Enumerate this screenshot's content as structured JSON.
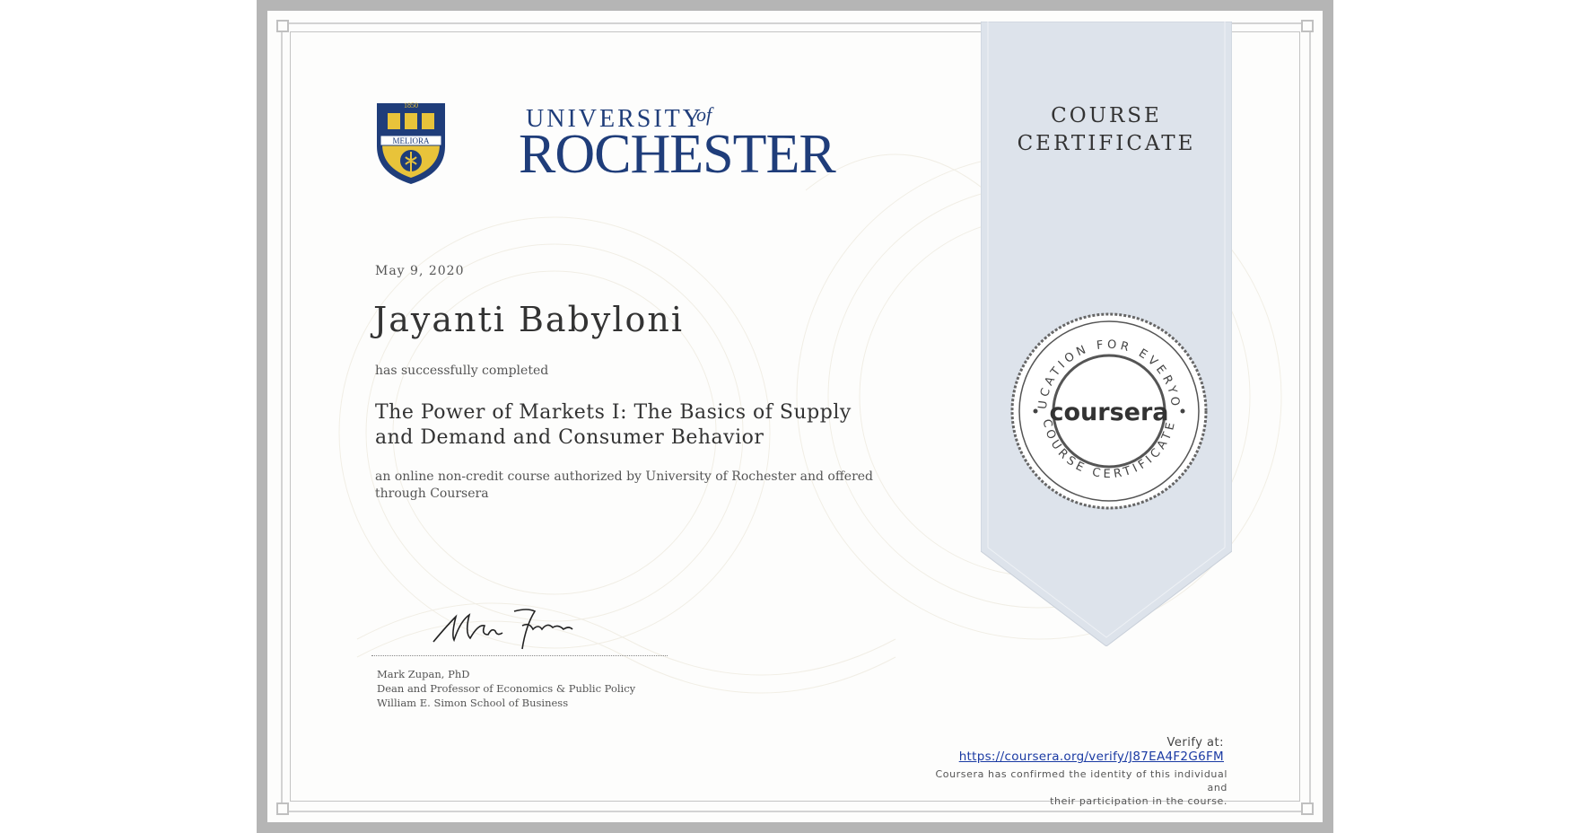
{
  "logo": {
    "institution_top": "UNIVERSITY",
    "institution_of": "of",
    "institution_main": "ROCHESTER",
    "crest_year": "1850",
    "crest_motto": "MELIORA"
  },
  "certificate": {
    "heading_line1": "COURSE",
    "heading_line2": "CERTIFICATE",
    "date": "May 9, 2020",
    "recipient": "Jayanti Babyloni",
    "completed_text": "has successfully completed",
    "course_title": "The Power of Markets I: The Basics of Supply and Demand and Consumer Behavior",
    "course_description": "an online non-credit course authorized by University of Rochester and offered through Coursera"
  },
  "signer": {
    "name": "Mark Zupan, PhD",
    "title": "Dean and Professor of Economics & Public Policy",
    "school": "William E. Simon School of Business"
  },
  "seal": {
    "brand": "coursera",
    "top_arc": "EDUCATION FOR EVERYONE",
    "bottom_arc": "COURSE CERTIFICATE"
  },
  "verification": {
    "label": "Verify at:",
    "url": "https://coursera.org/verify/J87EA4F2G6FM",
    "note_line1": "Coursera has confirmed the identity of this individual and",
    "note_line2": "their participation in the course."
  },
  "colors": {
    "brand_blue": "#1f3d7a",
    "crest_gold": "#e8c33a",
    "ribbon": "#dde3eb",
    "link": "#1a3aa3"
  }
}
